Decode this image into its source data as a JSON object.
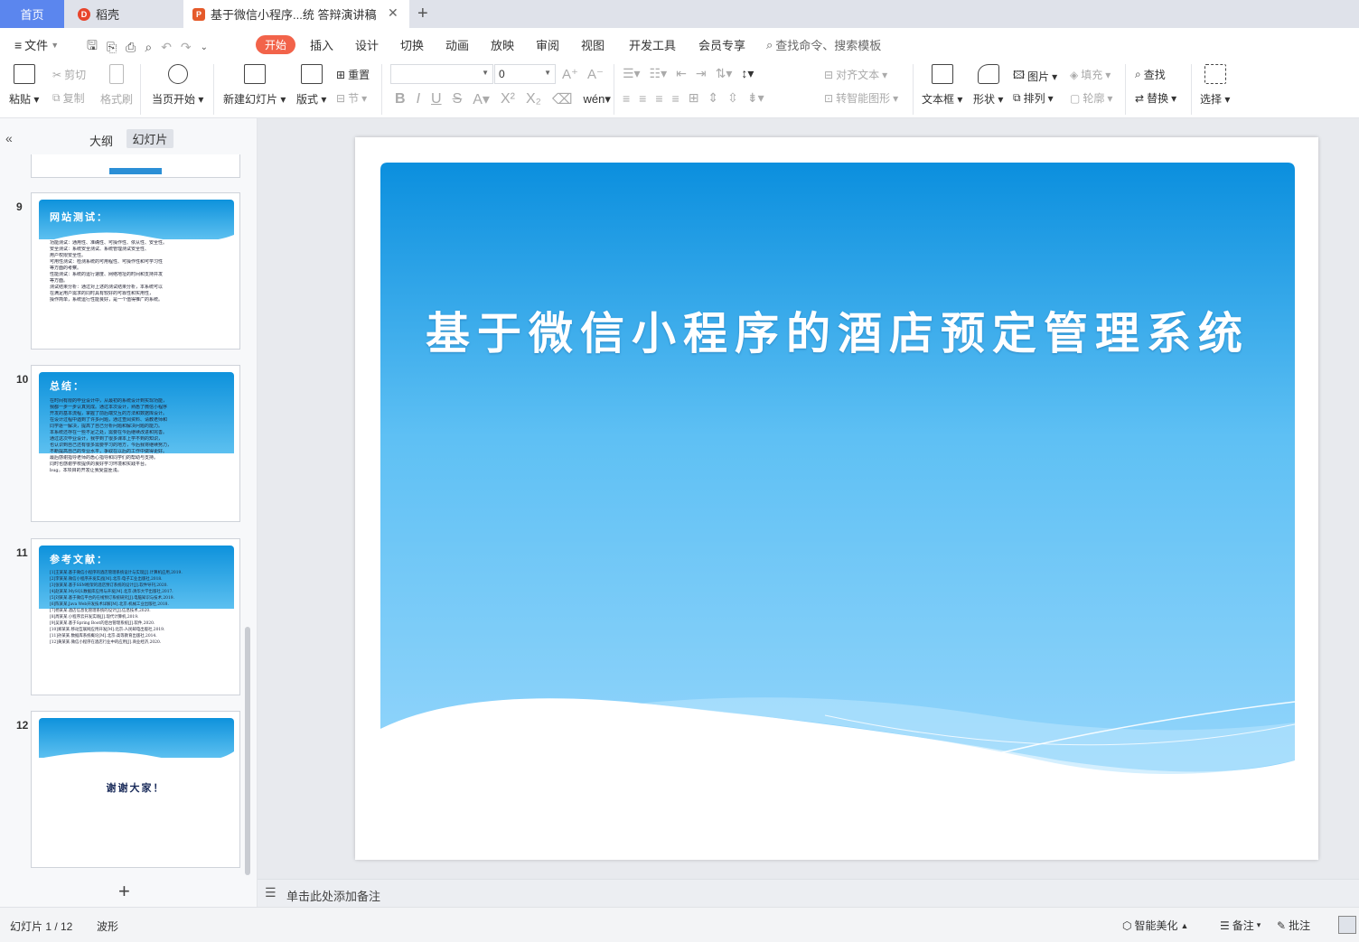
{
  "tabs": {
    "home": "首页",
    "daoke": "稻壳",
    "doc": "基于微信小程序...统 答辩演讲稿",
    "add": "+"
  },
  "menu": {
    "file": "文件",
    "items": [
      "开始",
      "插入",
      "设计",
      "切换",
      "动画",
      "放映",
      "审阅",
      "视图",
      "开发工具",
      "会员专享"
    ],
    "search": "查找命令、搜索模板"
  },
  "toolbar": {
    "paste": "粘贴",
    "cut": "剪切",
    "copy": "复制",
    "format_painter": "格式刷",
    "play_current": "当页开始",
    "new_slide": "新建幻灯片",
    "layout": "版式",
    "reset": "重置",
    "section": "节",
    "font_size": "0",
    "align_text": "对齐文本",
    "smart_graphic": "转智能图形",
    "textbox": "文本框",
    "shape": "形状",
    "picture": "图片",
    "arrange": "排列",
    "fill": "填充",
    "outline": "轮廓",
    "find": "查找",
    "replace": "替换",
    "select": "选择"
  },
  "panel": {
    "outline_tab": "大纲",
    "slides_tab": "幻灯片",
    "thumbs": [
      {
        "num": "9",
        "title": "网站测试：",
        "lines": [
          "功能测试：通用性、准确性、可操作性、依从性、安全性。",
          "安全测试：系统安全测试、系统管理测试安全性、",
          "用户权限安全性。",
          "可用性测试：检测系统的可用程性、可操作性和可学习性",
          "等方面的考察。",
          "性能测试：系统的运行速度、网络地址的时间和支持并发",
          "等方面。",
          "测试结果分析：通过对上述的测试结果分析，本系统可以",
          "在满足用户需求的同时具有较好的可靠性和实用性，",
          "操作简单，系统运行性能良好，是一个值得推广的系统。"
        ]
      },
      {
        "num": "10",
        "title": "总结：",
        "lines": [
          "在时间有限的毕业设计中，从最初的系统设计到实现功能，",
          "我都一步一步认真完成。通过本次设计，熟悉了微信小程序",
          "开发的基本流程，掌握了前后端交互的方法和数据库设计。",
          "在设计过程中遇到了许多问题，通过查阅资料、请教老师和",
          "同学逐一解决，提高了自己分析问题和解决问题的能力。",
          "本系统还存在一些不足之处，需要在今后继续改进和完善。",
          "通过这次毕业设计，我学到了很多课本上学不到的知识，",
          "也认识到自己还有很多需要学习的地方，今后我将继续努力，",
          "不断提高自己的专业水平，争取在以后的工作中做得更好。",
          "最后感谢指导老师的悉心指导和同学们的帮助与支持。",
          "同时也感谢学校提供的良好学习环境和实践平台。",
          "bug。本项目的开发让我受益匪浅。"
        ]
      },
      {
        "num": "11",
        "title": "参考文献：",
        "lines": [
          "[1]王某某.基于微信小程序的酒店管理系统设计与实现[J].计算机应用,2019.",
          "[2]李某某.微信小程序开发实战[M].北京:电子工业出版社,2018.",
          "[3]张某某.基于SSM框架的酒店预订系统的设计[J].软件导刊,2020.",
          "[4]赵某某.MySQL数据库应用与开发[M].北京:清华大学出版社,2017.",
          "[5]刘某某.基于微信平台的在线预订系统研究[J].电脑知识与技术,2019.",
          "[6]陈某某.Java Web开发技术详解[M].北京:机械工业出版社,2018.",
          "[7]杨某某.酒店信息化管理系统的设计[J].信息技术,2020.",
          "[8]周某某.小程序云开发实践[J].现代计算机,2019.",
          "[9]吴某某.基于Spring Boot的后台管理系统[J].软件,2020.",
          "[10]郑某某.移动互联网应用开发[M].北京:人民邮电出版社,2019.",
          "[11]孙某某.数据库系统概论[M].北京:高等教育出版社,2014.",
          "[12]黄某某.微信小程序在酒店行业中的应用[J].商业经济,2020."
        ]
      },
      {
        "num": "12",
        "title": "谢谢大家！",
        "lines": []
      }
    ],
    "add": "+"
  },
  "slide": {
    "title": "基于微信小程序的酒店预定管理系统"
  },
  "notes": {
    "placeholder": "单击此处添加备注"
  },
  "status": {
    "slide_count": "幻灯片 1 / 12",
    "theme": "波形",
    "beautify": "智能美化",
    "notes": "备注",
    "comment": "批注"
  }
}
